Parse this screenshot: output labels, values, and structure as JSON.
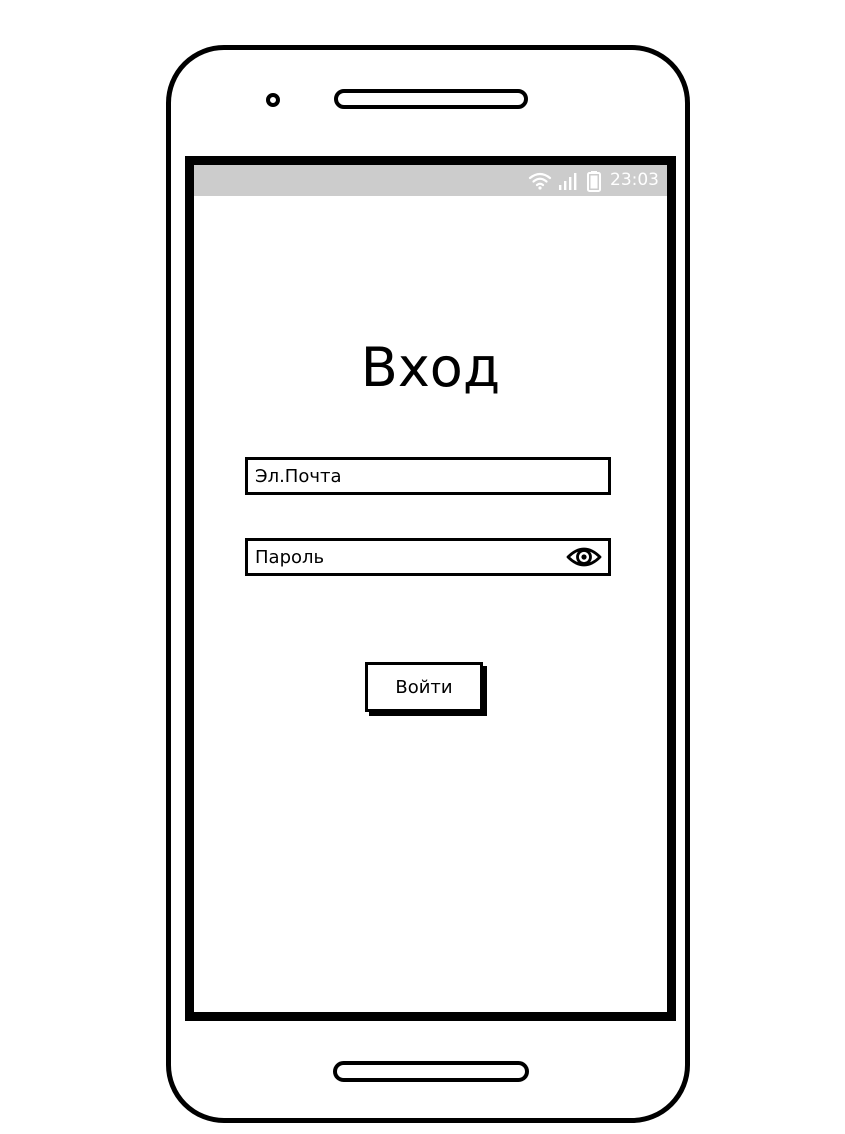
{
  "status_bar": {
    "time": "23:03",
    "icons": [
      "wifi-icon",
      "signal-icon",
      "battery-icon"
    ]
  },
  "login": {
    "title": "Вход",
    "email": {
      "placeholder": "Эл.Почта"
    },
    "password": {
      "placeholder": "Пароль",
      "toggle_icon": "eye-icon"
    },
    "submit_label": "Войти"
  }
}
